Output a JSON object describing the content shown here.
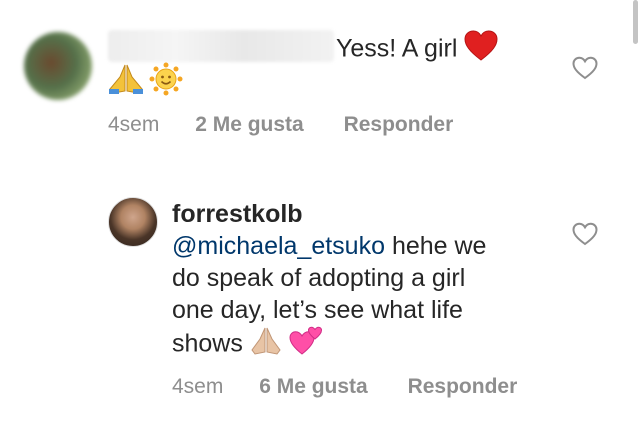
{
  "comments": [
    {
      "username": "",
      "text": "Yess! A girl",
      "time": "4sem",
      "likes": "2 Me gusta",
      "reply": "Responder"
    },
    {
      "username": "forrestkolb",
      "mention": "@michaela_etsuko",
      "text_line1": " hehe we",
      "text_line2": "do speak of adopting a girl",
      "text_line3": "one day, let’s see what life",
      "text_line4": "shows",
      "time": "4sem",
      "likes": "6 Me gusta",
      "reply": "Responder"
    }
  ],
  "icons": {
    "heart_emoji": "red-heart-icon",
    "pray_emoji": "folded-hands-icon",
    "sun_emoji": "sun-face-icon",
    "two_hearts_emoji": "two-hearts-icon",
    "like_button": "heart-outline-icon"
  },
  "colors": {
    "mention": "#00376b",
    "meta": "#8e8e8e",
    "text": "#262626"
  }
}
